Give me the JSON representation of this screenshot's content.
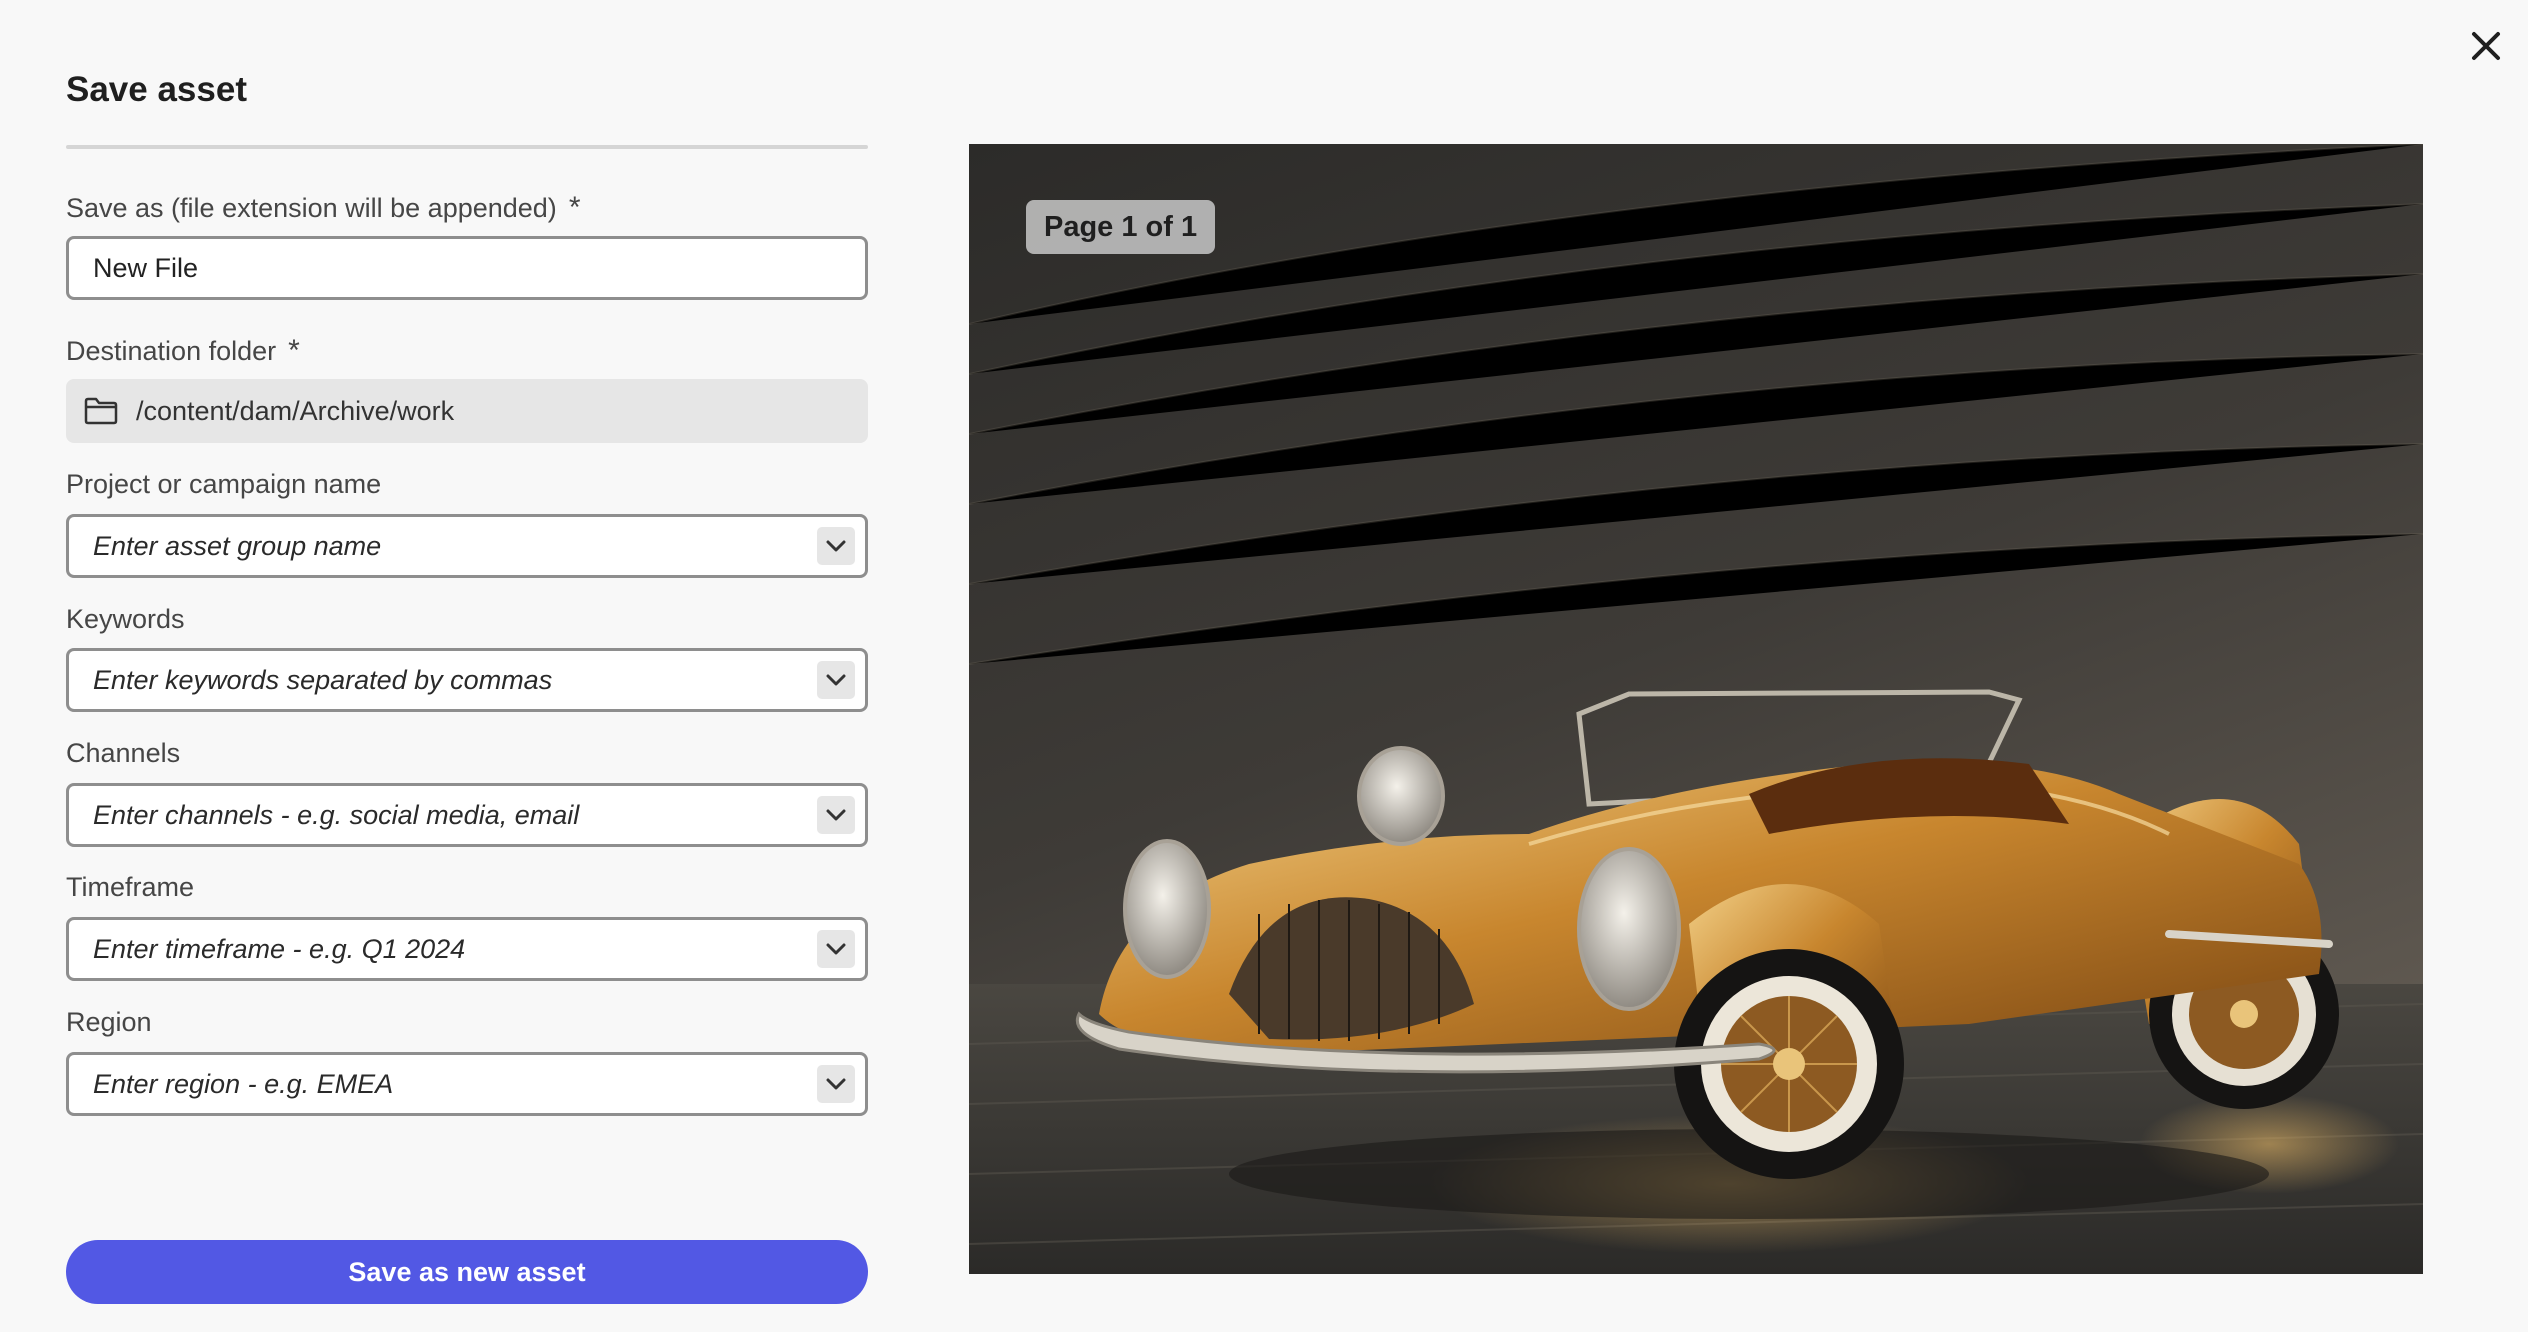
{
  "dialog": {
    "title": "Save asset"
  },
  "form": {
    "save_as": {
      "label": "Save as (file extension will be appended)",
      "required_mark": "*",
      "value": "New File"
    },
    "destination": {
      "label": "Destination folder",
      "required_mark": "*",
      "path": "/content/dam/Archive/work",
      "icon": "folder-icon"
    },
    "project": {
      "label": "Project or campaign name",
      "placeholder": "Enter asset group name"
    },
    "keywords": {
      "label": "Keywords",
      "placeholder": "Enter keywords separated by commas"
    },
    "channels": {
      "label": "Channels",
      "placeholder": "Enter channels - e.g. social media, email"
    },
    "timeframe": {
      "label": "Timeframe",
      "placeholder": "Enter timeframe - e.g. Q1 2024"
    },
    "region": {
      "label": "Region",
      "placeholder": "Enter region - e.g. EMEA"
    },
    "submit_label": "Save as new asset"
  },
  "preview": {
    "page_indicator": "Page 1 of 1"
  },
  "colors": {
    "primary_button": "#5258e4",
    "background": "#f8f8f8"
  }
}
